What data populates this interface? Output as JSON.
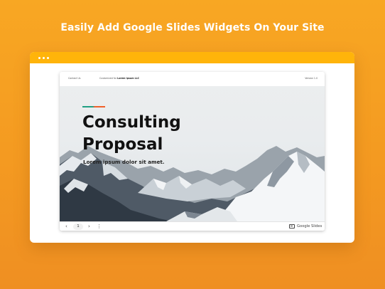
{
  "headline": "Easily Add Google Slides Widgets On Your Site",
  "slide": {
    "header_left": "Contact Us",
    "header_mid_prefix": "Customized for",
    "header_mid_bold": "Lorem Ipsum LLC",
    "header_right": "Version 1.0",
    "title_line1": "Consulting",
    "title_line2": "Proposal",
    "subtitle": "Lorem ipsum dolor sit amet."
  },
  "controls": {
    "prev_glyph": "‹",
    "page": "1",
    "next_glyph": "›",
    "menu_glyph": "⋮",
    "brand": "Google Slides",
    "brand_icon": "slides-icon"
  },
  "colors": {
    "background": "#f5a022",
    "browser_bar": "#ffb40a",
    "accent_green": "#20a083",
    "accent_orange": "#f0602a"
  }
}
